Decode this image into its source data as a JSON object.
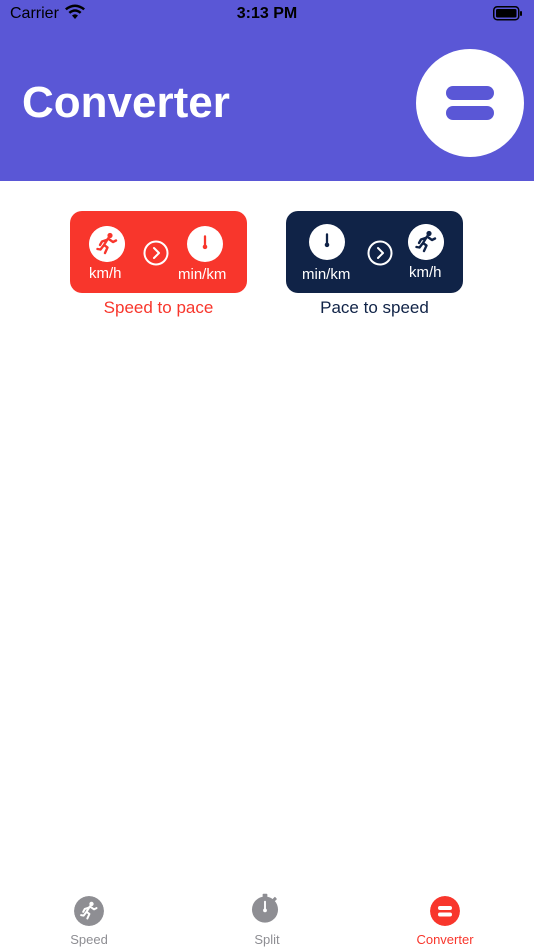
{
  "status_bar": {
    "carrier": "Carrier",
    "time": "3:13 PM"
  },
  "header": {
    "title": "Converter",
    "menu_icon": "equal-icon"
  },
  "converters": [
    {
      "from_unit": "km/h",
      "to_unit": "min/km",
      "caption": "Speed to pace",
      "color": "#f8362c",
      "caption_color": "#f8362c",
      "from_icon": "runner-icon",
      "to_icon": "stopwatch-icon"
    },
    {
      "from_unit": "min/km",
      "to_unit": "km/h",
      "caption": "Pace to speed",
      "color": "#102347",
      "caption_color": "#102347",
      "from_icon": "stopwatch-icon",
      "to_icon": "runner-icon"
    }
  ],
  "tabs": [
    {
      "label": "Speed",
      "icon": "runner-icon",
      "active": false
    },
    {
      "label": "Split",
      "icon": "stopwatch-icon",
      "active": false
    },
    {
      "label": "Converter",
      "icon": "equal-icon",
      "active": true
    }
  ],
  "colors": {
    "header": "#5a57d6",
    "accent": "#f8362c",
    "navy": "#102347",
    "inactive": "#8e8e93"
  }
}
